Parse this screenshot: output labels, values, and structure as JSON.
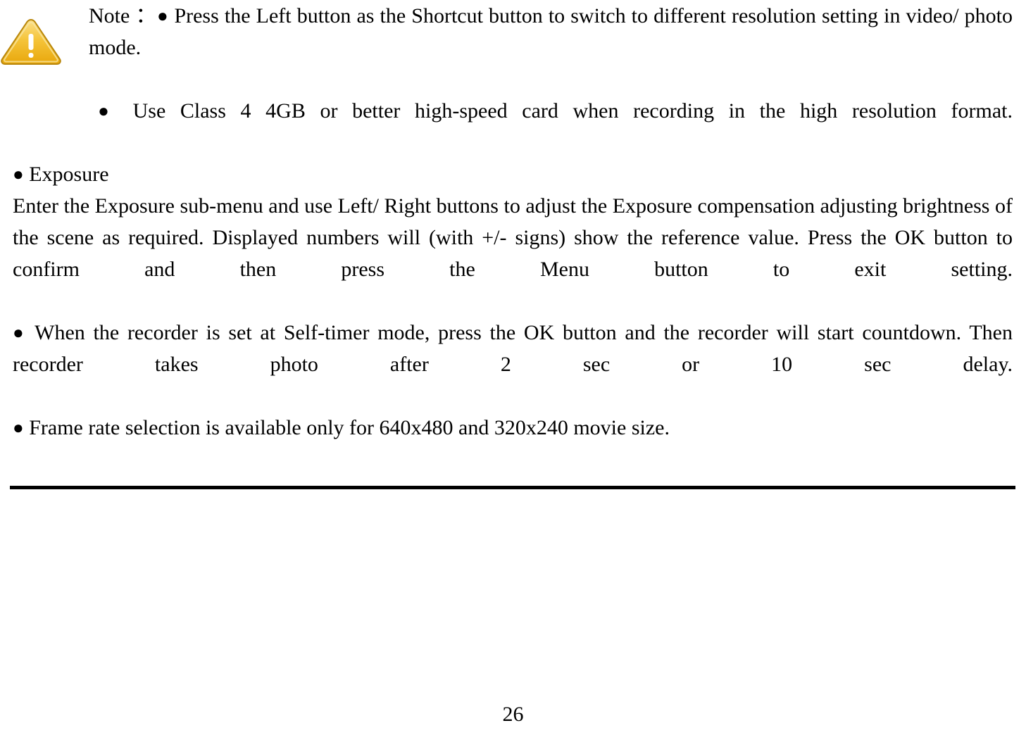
{
  "document": {
    "warning_icon": "warning-triangle-icon",
    "note_label": "Note ：",
    "note_bullets": [
      "Press the Left button as the Shortcut button to switch to different resolution setting in video/ photo mode.",
      "Use Class 4 4GB or better high-speed card when recording in the high resolution format."
    ],
    "sections": [
      {
        "heading": "Exposure",
        "paragraph": "Enter the Exposure sub-menu and use Left/ Right buttons to adjust the Exposure compensation adjusting brightness of the scene as required. Displayed numbers will (with +/- signs) show the reference value. Press the OK button to confirm and then press the Menu button to exit setting."
      }
    ],
    "bullets": [
      "When the recorder is set at Self-timer mode, press the OK button and the recorder will start countdown. Then recorder takes photo after 2 sec or 10 sec delay.",
      "Frame rate selection is available only for 640x480 and 320x240 movie size."
    ],
    "page_number": "26",
    "bullet_glyph": "●"
  }
}
